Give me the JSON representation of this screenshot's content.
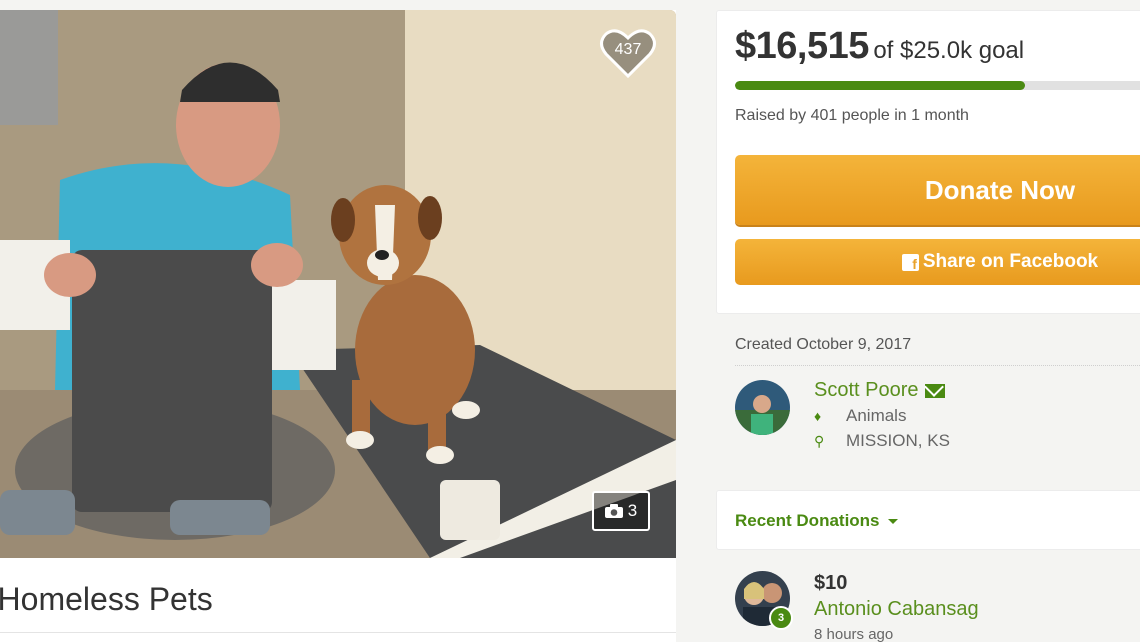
{
  "campaign": {
    "title": "r Homeless Pets",
    "likes": "437",
    "photo_count": "3"
  },
  "funding": {
    "raised": "$16,515",
    "goal": "of $25.0k goal",
    "progress_fraction": 0.66,
    "raised_by": "Raised by 401 people in 1 month",
    "donate_label": "Donate Now",
    "share_label": "Share on Facebook"
  },
  "organizer": {
    "created": "Created October 9, 2017",
    "name": "Scott Poore",
    "category": "Animals",
    "location": "MISSION, KS"
  },
  "recent": {
    "label": "Recent Donations"
  },
  "donation": {
    "amount": "$10",
    "name": "Antonio Cabansag",
    "time": "8 hours ago",
    "badge": "3"
  },
  "icons": [
    "heart-icon",
    "camera-icon",
    "facebook-icon",
    "mail-icon",
    "tag-icon",
    "location-pin-icon",
    "chevron-down-icon"
  ],
  "colors": {
    "accent_green": "#4a8a12",
    "donate_orange": "#eda52b"
  }
}
